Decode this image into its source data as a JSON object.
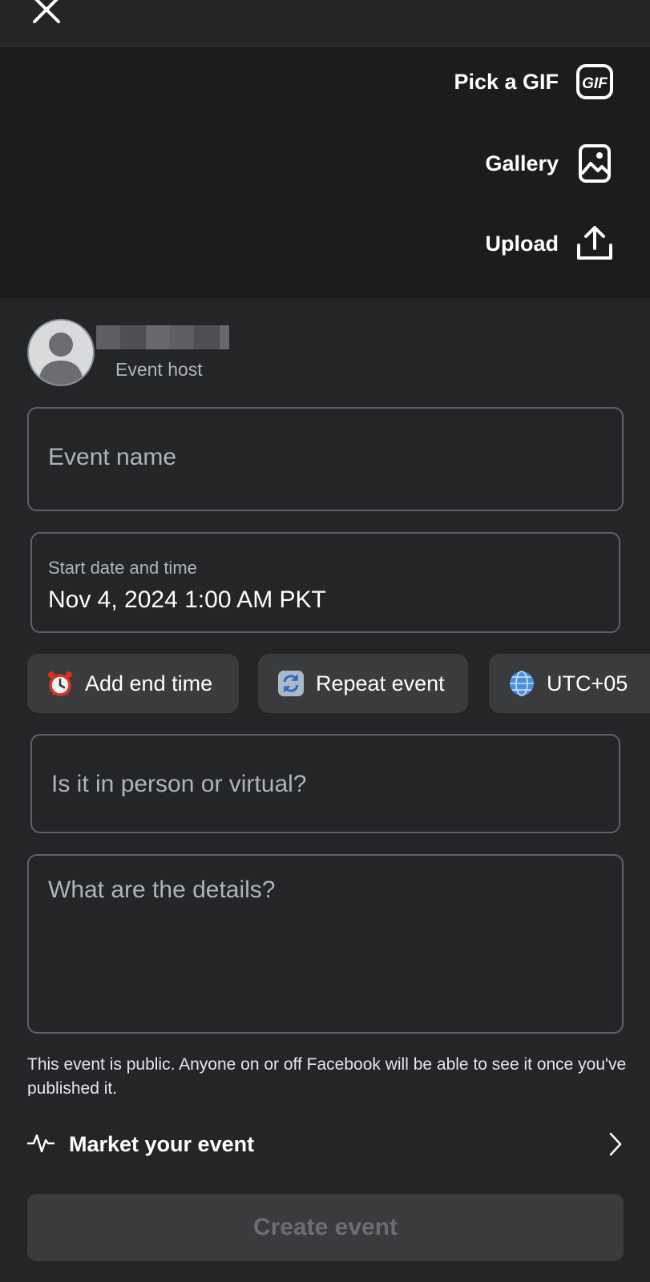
{
  "header": {
    "close_icon": "close-icon"
  },
  "media": {
    "options": [
      {
        "label": "Pick a GIF",
        "icon": "gif-icon"
      },
      {
        "label": "Gallery",
        "icon": "gallery-icon"
      },
      {
        "label": "Upload",
        "icon": "upload-icon"
      }
    ]
  },
  "host": {
    "role": "Event host",
    "avatar_icon": "avatar-icon"
  },
  "form": {
    "event_name_placeholder": "Event name",
    "start_label": "Start date and time",
    "start_value": "Nov 4, 2024 1:00 AM PKT",
    "location_placeholder": "Is it in person or virtual?",
    "details_placeholder": "What are the details?"
  },
  "chips": [
    {
      "label": "Add end time",
      "icon": "alarm-clock-icon"
    },
    {
      "label": "Repeat event",
      "icon": "repeat-icon"
    },
    {
      "label": "UTC+05",
      "icon": "globe-icon"
    }
  ],
  "notice": "This event is public. Anyone on or off Facebook will be able to see it once you've published it.",
  "market": {
    "label": "Market your event",
    "icon": "activity-icon"
  },
  "footer": {
    "create_label": "Create event"
  },
  "colors": {
    "background": "#242527",
    "panel": "#1c1c1d",
    "chip": "#3a3b3c",
    "border": "#5f6165"
  }
}
